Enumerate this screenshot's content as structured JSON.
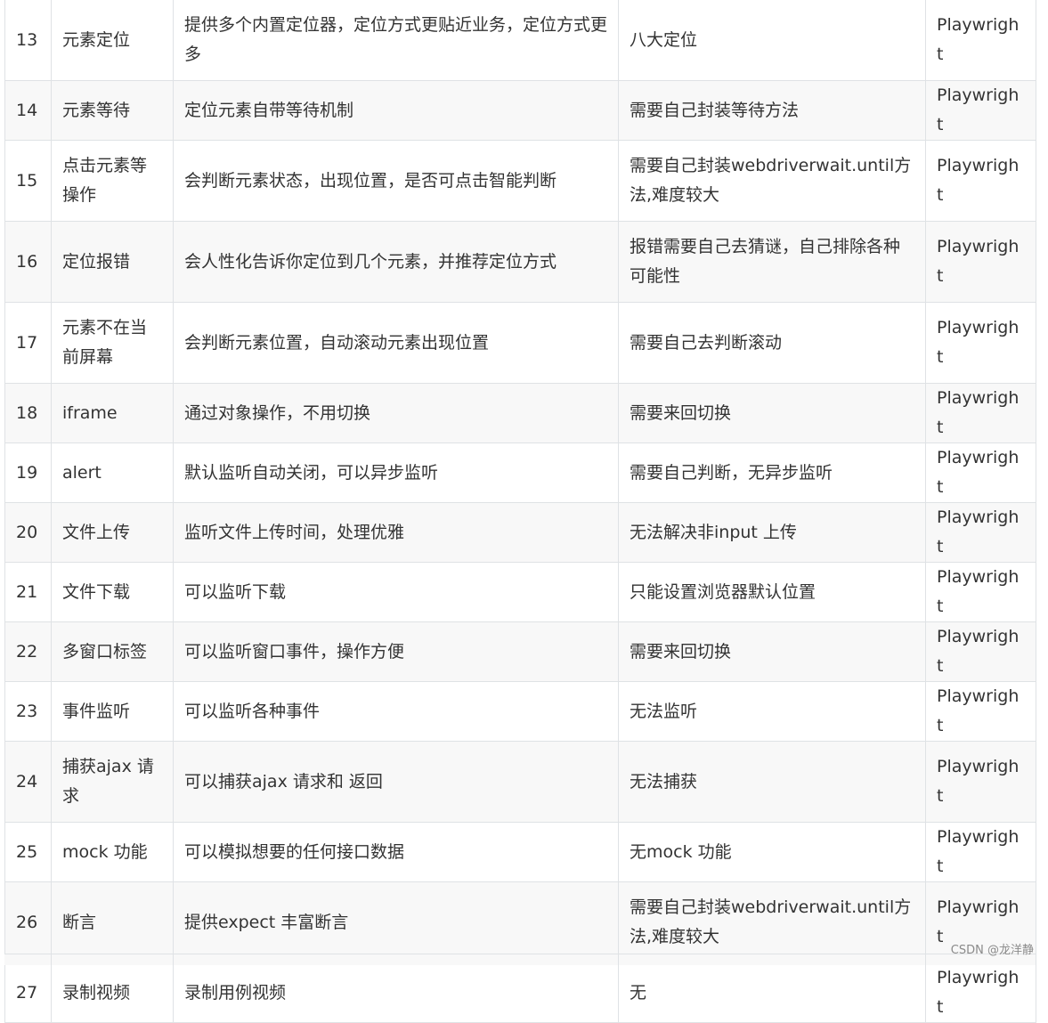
{
  "rows": [
    {
      "num": "13",
      "feature": "元素定位",
      "playwright": "提供多个内置定位器，定位方式更贴近业务，定位方式更多",
      "selenium": "八大定位",
      "winner": "Playwright"
    },
    {
      "num": "14",
      "feature": "元素等待",
      "playwright": "定位元素自带等待机制",
      "selenium": "需要自己封装等待方法",
      "winner": "Playwright"
    },
    {
      "num": "15",
      "feature": "点击元素等操作",
      "playwright": "会判断元素状态，出现位置，是否可点击智能判断",
      "selenium": "需要自己封装webdriverwait.until方法,难度较大",
      "winner": "Playwright"
    },
    {
      "num": "16",
      "feature": "定位报错",
      "playwright": "会人性化告诉你定位到几个元素，并推荐定位方式",
      "selenium": "报错需要自己去猜谜，自己排除各种可能性",
      "winner": "Playwright"
    },
    {
      "num": "17",
      "feature": "元素不在当前屏幕",
      "playwright": "会判断元素位置，自动滚动元素出现位置",
      "selenium": "需要自己去判断滚动",
      "winner": "Playwright"
    },
    {
      "num": "18",
      "feature": "iframe",
      "playwright": "通过对象操作，不用切换",
      "selenium": "需要来回切换",
      "winner": "Playwright"
    },
    {
      "num": "19",
      "feature": "alert",
      "playwright": "默认监听自动关闭，可以异步监听",
      "selenium": "需要自己判断，无异步监听",
      "winner": "Playwright"
    },
    {
      "num": "20",
      "feature": "文件上传",
      "playwright": "监听文件上传时间，处理优雅",
      "selenium": "无法解决非input 上传",
      "winner": "Playwright"
    },
    {
      "num": "21",
      "feature": "文件下载",
      "playwright": "可以监听下载",
      "selenium": "只能设置浏览器默认位置",
      "winner": "Playwright"
    },
    {
      "num": "22",
      "feature": "多窗口标签",
      "playwright": "可以监听窗口事件，操作方便",
      "selenium": "需要来回切换",
      "winner": "Playwright"
    },
    {
      "num": "23",
      "feature": "事件监听",
      "playwright": "可以监听各种事件",
      "selenium": "无法监听",
      "winner": "Playwright"
    },
    {
      "num": "24",
      "feature": "捕获ajax 请求",
      "playwright": "可以捕获ajax 请求和 返回",
      "selenium": "无法捕获",
      "winner": "Playwright"
    },
    {
      "num": "25",
      "feature": "mock 功能",
      "playwright": "可以模拟想要的任何接口数据",
      "selenium": "无mock 功能",
      "winner": "Playwright"
    },
    {
      "num": "26",
      "feature": "断言",
      "playwright": "提供expect 丰富断言",
      "selenium": "需要自己封装webdriverwait.until方法,难度较大",
      "winner": "Playwright"
    },
    {
      "num": "27",
      "feature": "录制视频",
      "playwright": "录制用例视频",
      "selenium": "无",
      "winner": "Playwright"
    }
  ],
  "watermark": "CSDN @龙洋静"
}
